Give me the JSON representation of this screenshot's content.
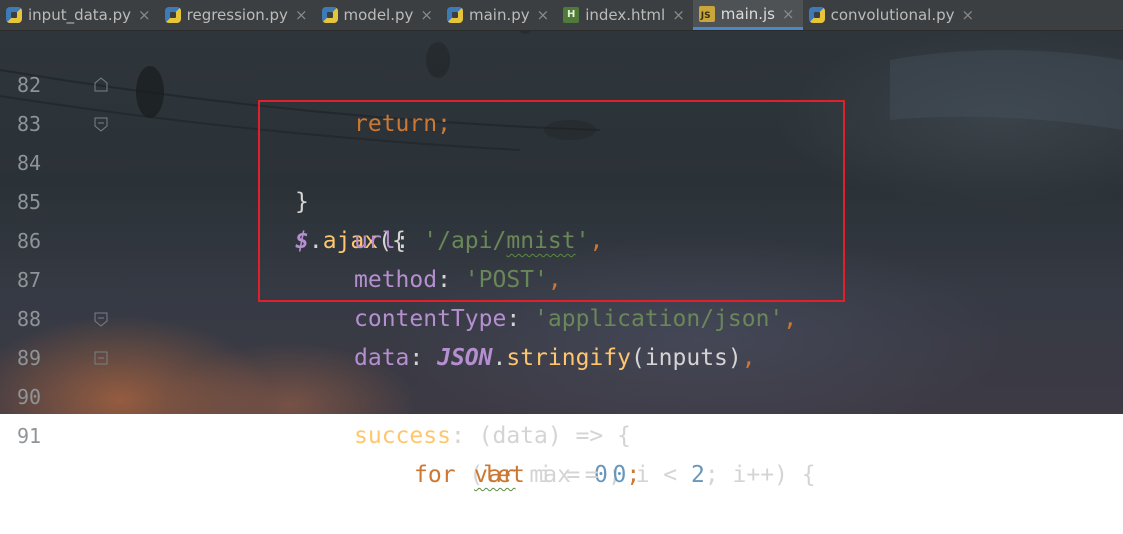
{
  "tabs": [
    {
      "label": "input_data.py",
      "type": "py"
    },
    {
      "label": "regression.py",
      "type": "py"
    },
    {
      "label": "model.py",
      "type": "py"
    },
    {
      "label": "main.py",
      "type": "py"
    },
    {
      "label": "index.html",
      "type": "html"
    },
    {
      "label": "main.js",
      "type": "js",
      "active": true
    },
    {
      "label": "convolutional.py",
      "type": "py"
    }
  ],
  "tab_icon_text": {
    "html": "H",
    "js": "JS"
  },
  "close_glyph": "×",
  "lines": {
    "l82": {
      "num": "82",
      "kw": "return",
      "semi": ";"
    },
    "l83": {
      "num": "83",
      "brace": "}"
    },
    "l84": {
      "num": "84",
      "dollar": "$",
      "dot": ".",
      "fn": "ajax",
      "punct": "({"
    },
    "l85": {
      "num": "85",
      "prop": "url",
      "colon": ": ",
      "q1": "'/api/",
      "squig": "mnist",
      "q2": "'",
      "comma": ","
    },
    "l86": {
      "num": "86",
      "prop": "method",
      "colon": ": ",
      "str": "'POST'",
      "comma": ","
    },
    "l87": {
      "num": "87",
      "prop": "contentType",
      "colon": ": ",
      "str": "'application/json'",
      "comma": ","
    },
    "l88": {
      "num": "88",
      "prop": "data",
      "colon": ": ",
      "json": "JSON",
      "dot": ".",
      "fn": "stringify",
      "args": "(inputs)",
      "comma": ","
    },
    "l89": {
      "num": "89",
      "prop": "success",
      "rest": ": (data) => {"
    },
    "l90": {
      "num": "90",
      "kw": "for",
      "p1": " (",
      "kw2": "let",
      "p2": " i = ",
      "n1": "0",
      "p3": "; i < ",
      "n2": "2",
      "p4": "; i++) {"
    },
    "l91": {
      "num": "91",
      "kw": "var",
      "p1": " max = ",
      "n1": "0",
      "semi": ";"
    }
  },
  "colors": {
    "highlight_box": "#e0202a",
    "keyword": "#cc7832",
    "string": "#6a8759",
    "number": "#6897bb",
    "property": "#b68fd0",
    "function": "#ffc66d",
    "active_tab_underline": "#4a88c7"
  }
}
